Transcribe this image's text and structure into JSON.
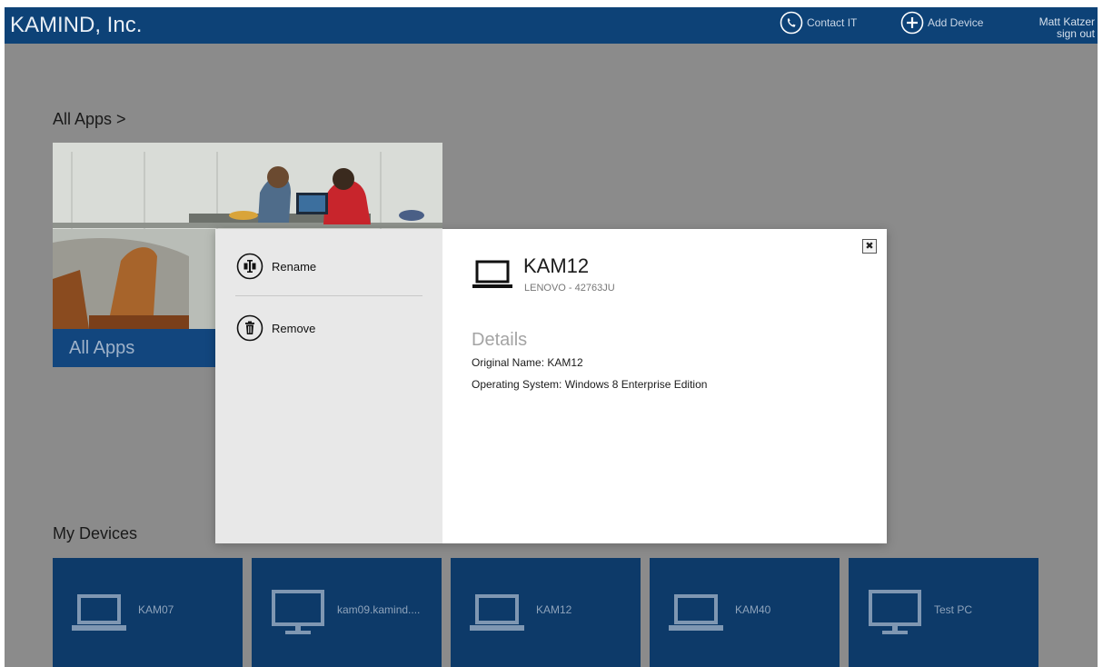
{
  "header": {
    "company": "KAMIND, Inc.",
    "contact_label": "Contact IT",
    "add_device_label": "Add Device",
    "user_name": "Matt Katzer",
    "sign_out": "sign out"
  },
  "sections": {
    "all_apps_heading": "All Apps >",
    "all_apps_tile_label": "All Apps",
    "my_devices_heading": "My Devices"
  },
  "devices": [
    {
      "name": "KAM07",
      "icon": "laptop-icon"
    },
    {
      "name": "kam09.kamind....",
      "icon": "monitor-icon"
    },
    {
      "name": "KAM12",
      "icon": "laptop-icon"
    },
    {
      "name": "KAM40",
      "icon": "laptop-icon"
    },
    {
      "name": "Test PC",
      "icon": "monitor-icon"
    }
  ],
  "modal": {
    "actions": {
      "rename": "Rename",
      "remove": "Remove"
    },
    "close_glyph": "✖",
    "device_name": "KAM12",
    "device_model": "LENOVO - 42763JU",
    "details_heading": "Details",
    "original_name": "Original Name: KAM12",
    "operating_system": "Operating System: Windows 8 Enterprise Edition"
  },
  "colors": {
    "header_bg": "#0d4277",
    "backdrop": "#8b8b8b",
    "tile_bg": "#0d3a69",
    "panel_bg": "#e8e8e8"
  }
}
